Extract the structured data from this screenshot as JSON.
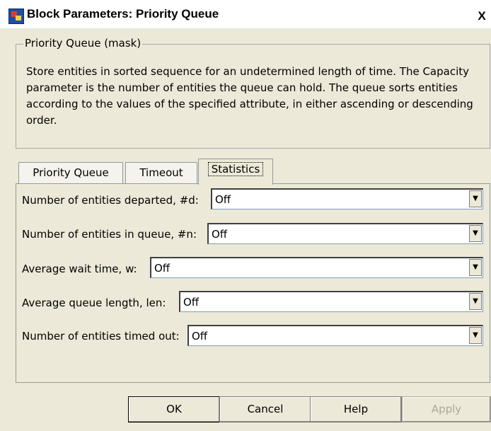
{
  "window": {
    "title": "Block Parameters: Priority Queue",
    "close_label": "X"
  },
  "mask": {
    "legend": "Priority Queue (mask)",
    "description": "Store entities in sorted sequence for an undetermined length of time. The Capacity parameter is the number of entities the queue can hold. The queue sorts entities according to the values of the specified attribute, in either ascending or descending order."
  },
  "tabs": [
    {
      "label": "Priority Queue",
      "active": false
    },
    {
      "label": "Timeout",
      "active": false
    },
    {
      "label": "Statistics",
      "active": true
    }
  ],
  "fields": [
    {
      "label": "Number of entities departed, #d:",
      "value": "Off"
    },
    {
      "label": "Number of entities in queue, #n:",
      "value": "Off"
    },
    {
      "label": "Average wait time, w:",
      "value": "Off"
    },
    {
      "label": "Average queue length, len:",
      "value": "Off"
    },
    {
      "label": "Number of entities timed out:",
      "value": "Off"
    }
  ],
  "buttons": {
    "ok": "OK",
    "cancel": "Cancel",
    "help": "Help",
    "apply": "Apply"
  },
  "icons": {
    "dropdown": "chevron-down-icon",
    "app": "simulink-block-icon"
  }
}
